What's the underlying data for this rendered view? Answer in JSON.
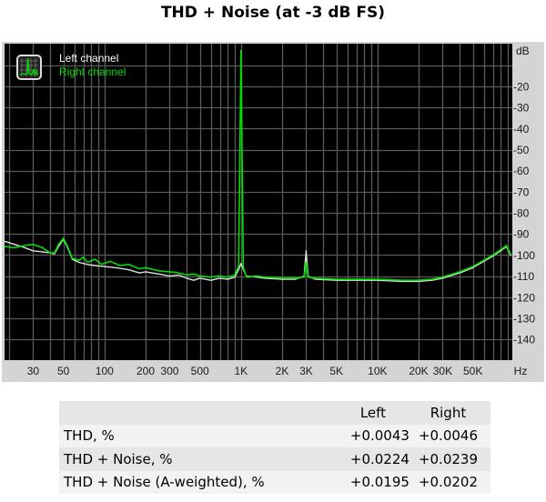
{
  "title": "THD + Noise (at -3 dB FS)",
  "chart_data": {
    "type": "line",
    "title": "THD + Noise (at -3 dB FS)",
    "xlabel": "Hz",
    "ylabel": "dB",
    "xscale": "log",
    "xlim": [
      18,
      100000
    ],
    "ylim": [
      -150,
      0
    ],
    "grid": true,
    "background": "#000000",
    "x_ticks": [
      {
        "value": 30,
        "label": "30"
      },
      {
        "value": 50,
        "label": "50"
      },
      {
        "value": 100,
        "label": "100"
      },
      {
        "value": 200,
        "label": "200"
      },
      {
        "value": 300,
        "label": "300"
      },
      {
        "value": 500,
        "label": "500"
      },
      {
        "value": 1000,
        "label": "1K"
      },
      {
        "value": 2000,
        "label": "2K"
      },
      {
        "value": 3000,
        "label": "3K"
      },
      {
        "value": 5000,
        "label": "5K"
      },
      {
        "value": 10000,
        "label": "10K"
      },
      {
        "value": 20000,
        "label": "20K"
      },
      {
        "value": 30000,
        "label": "30K"
      },
      {
        "value": 50000,
        "label": "50K"
      }
    ],
    "y_ticks": [
      {
        "value": -20,
        "label": "-20"
      },
      {
        "value": -30,
        "label": "-30"
      },
      {
        "value": -40,
        "label": "-40"
      },
      {
        "value": -50,
        "label": "-50"
      },
      {
        "value": -60,
        "label": "-60"
      },
      {
        "value": -70,
        "label": "-70"
      },
      {
        "value": -80,
        "label": "-80"
      },
      {
        "value": -90,
        "label": "-90"
      },
      {
        "value": -100,
        "label": "-100"
      },
      {
        "value": -110,
        "label": "-110"
      },
      {
        "value": -120,
        "label": "-120"
      },
      {
        "value": -130,
        "label": "-130"
      },
      {
        "value": -140,
        "label": "-140"
      }
    ],
    "legend": {
      "placement": "top-left",
      "entries": [
        {
          "name": "Left channel",
          "color": "#ffffff"
        },
        {
          "name": "Right channel",
          "color": "#00dd00"
        }
      ]
    },
    "series": [
      {
        "name": "Left channel",
        "color": "#e0e0e0",
        "points": [
          [
            18,
            -93.5
          ],
          [
            22,
            -95
          ],
          [
            26,
            -96.5
          ],
          [
            30,
            -98
          ],
          [
            35,
            -98.5
          ],
          [
            40,
            -99
          ],
          [
            43,
            -99.5
          ],
          [
            46,
            -96
          ],
          [
            50,
            -92.5
          ],
          [
            54,
            -97
          ],
          [
            58,
            -102
          ],
          [
            65,
            -103.5
          ],
          [
            75,
            -104.5
          ],
          [
            85,
            -105
          ],
          [
            100,
            -105.5
          ],
          [
            120,
            -106
          ],
          [
            150,
            -107
          ],
          [
            180,
            -108.5
          ],
          [
            200,
            -108
          ],
          [
            250,
            -109
          ],
          [
            300,
            -110
          ],
          [
            350,
            -109.5
          ],
          [
            400,
            -111
          ],
          [
            450,
            -112
          ],
          [
            500,
            -111
          ],
          [
            600,
            -112
          ],
          [
            700,
            -111
          ],
          [
            800,
            -111.5
          ],
          [
            900,
            -110.5
          ],
          [
            960,
            -107
          ],
          [
            1000,
            -104
          ],
          [
            1040,
            -107
          ],
          [
            1100,
            -110
          ],
          [
            1300,
            -110.5
          ],
          [
            1500,
            -111
          ],
          [
            2000,
            -111.5
          ],
          [
            2500,
            -111.5
          ],
          [
            2900,
            -110
          ],
          [
            3000,
            -98
          ],
          [
            3100,
            -110
          ],
          [
            3500,
            -111.5
          ],
          [
            5000,
            -112
          ],
          [
            7000,
            -112
          ],
          [
            10000,
            -112
          ],
          [
            15000,
            -112.5
          ],
          [
            20000,
            -112.5
          ],
          [
            25000,
            -112
          ],
          [
            30000,
            -111
          ],
          [
            40000,
            -108.5
          ],
          [
            50000,
            -106
          ],
          [
            60000,
            -103
          ],
          [
            70000,
            -100.5
          ],
          [
            80000,
            -98
          ],
          [
            88000,
            -96
          ],
          [
            95000,
            -100.5
          ]
        ]
      },
      {
        "name": "Right channel",
        "color": "#00dd00",
        "points": [
          [
            18,
            -96
          ],
          [
            22,
            -96.5
          ],
          [
            26,
            -95.5
          ],
          [
            30,
            -95
          ],
          [
            35,
            -96.5
          ],
          [
            40,
            -99
          ],
          [
            43,
            -99
          ],
          [
            46,
            -95
          ],
          [
            50,
            -92
          ],
          [
            54,
            -96.5
          ],
          [
            58,
            -101.5
          ],
          [
            65,
            -102.5
          ],
          [
            70,
            -101
          ],
          [
            75,
            -103.5
          ],
          [
            85,
            -102
          ],
          [
            95,
            -104.5
          ],
          [
            110,
            -103
          ],
          [
            130,
            -105
          ],
          [
            150,
            -104.5
          ],
          [
            180,
            -106.5
          ],
          [
            200,
            -106
          ],
          [
            250,
            -107.5
          ],
          [
            300,
            -108
          ],
          [
            350,
            -108.5
          ],
          [
            400,
            -109.5
          ],
          [
            450,
            -109
          ],
          [
            500,
            -110
          ],
          [
            600,
            -110.5
          ],
          [
            700,
            -110
          ],
          [
            800,
            -110.5
          ],
          [
            900,
            -109.5
          ],
          [
            960,
            -105
          ],
          [
            990,
            -30
          ],
          [
            1000,
            -3
          ],
          [
            1010,
            -30
          ],
          [
            1040,
            -106
          ],
          [
            1100,
            -110.5
          ],
          [
            1300,
            -110
          ],
          [
            1500,
            -110.5
          ],
          [
            2000,
            -111
          ],
          [
            2500,
            -111
          ],
          [
            2900,
            -110.5
          ],
          [
            3000,
            -103.5
          ],
          [
            3100,
            -110.5
          ],
          [
            3500,
            -111
          ],
          [
            5000,
            -111.5
          ],
          [
            7000,
            -111.5
          ],
          [
            10000,
            -111.5
          ],
          [
            15000,
            -112
          ],
          [
            20000,
            -112
          ],
          [
            25000,
            -111.5
          ],
          [
            30000,
            -110.5
          ],
          [
            40000,
            -108
          ],
          [
            50000,
            -105.5
          ],
          [
            60000,
            -102.5
          ],
          [
            70000,
            -100
          ],
          [
            80000,
            -97.5
          ],
          [
            88000,
            -95.5
          ],
          [
            95000,
            -100
          ]
        ]
      }
    ]
  },
  "table": {
    "columns": [
      "",
      "Left",
      "Right"
    ],
    "rows": [
      {
        "label": "THD, %",
        "left": "+0.0043",
        "right": "+0.0046"
      },
      {
        "label": "THD + Noise, %",
        "left": "+0.0224",
        "right": "+0.0239"
      },
      {
        "label": "THD + Noise (A-weighted), %",
        "left": "+0.0195",
        "right": "+0.0202"
      }
    ]
  }
}
